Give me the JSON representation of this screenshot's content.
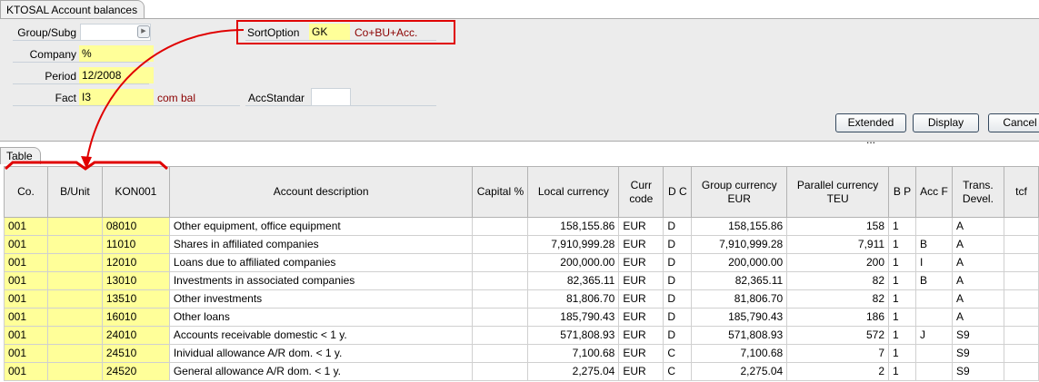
{
  "window": {
    "title": "KTOSAL Account balances"
  },
  "form": {
    "group_label": "Group/Subg",
    "group_value": "",
    "company_label": "Company",
    "company_value": "%",
    "period_label": "Period",
    "period_value": "12/2008",
    "fact_label": "Fact",
    "fact_value": "I3",
    "fact_desc": "com bal",
    "sort_label": "SortOption",
    "sort_value": "GK",
    "sort_desc": "Co+BU+Acc.",
    "accstd_label": "AccStandar",
    "accstd_value": ""
  },
  "buttons": {
    "extended": "Extended ...",
    "display": "Display",
    "cancel": "Cancel"
  },
  "table": {
    "tab_label": "Table",
    "headers": {
      "co": "Co.",
      "bunit": "B/Unit",
      "kon": "KON001",
      "desc": "Account description",
      "capital": "Capital %",
      "local": "Local currency",
      "curr": "Curr code",
      "dc": "D C",
      "group": "Group currency EUR",
      "parallel": "Parallel currency TEU",
      "bp": "B P",
      "acc": "Acc F",
      "trans": "Trans. Devel.",
      "tcf": "tcf"
    },
    "rows": [
      {
        "co": "001",
        "bunit": "",
        "kon": "08010",
        "desc": "Other equipment, office equipment",
        "capital": "",
        "local": "158,155.86",
        "curr": "EUR",
        "dc": "D",
        "group": "158,155.86",
        "parallel": "158",
        "bp": "1",
        "acc": "",
        "trans": "A",
        "tcf": ""
      },
      {
        "co": "001",
        "bunit": "",
        "kon": "11010",
        "desc": "Shares in affiliated companies",
        "capital": "",
        "local": "7,910,999.28",
        "curr": "EUR",
        "dc": "D",
        "group": "7,910,999.28",
        "parallel": "7,911",
        "bp": "1",
        "acc": "B",
        "trans": "A",
        "tcf": ""
      },
      {
        "co": "001",
        "bunit": "",
        "kon": "12010",
        "desc": "Loans due to affiliated companies",
        "capital": "",
        "local": "200,000.00",
        "curr": "EUR",
        "dc": "D",
        "group": "200,000.00",
        "parallel": "200",
        "bp": "1",
        "acc": "I",
        "trans": "A",
        "tcf": ""
      },
      {
        "co": "001",
        "bunit": "",
        "kon": "13010",
        "desc": "Investments in associated companies",
        "capital": "",
        "local": "82,365.11",
        "curr": "EUR",
        "dc": "D",
        "group": "82,365.11",
        "parallel": "82",
        "bp": "1",
        "acc": "B",
        "trans": "A",
        "tcf": ""
      },
      {
        "co": "001",
        "bunit": "",
        "kon": "13510",
        "desc": "Other investments",
        "capital": "",
        "local": "81,806.70",
        "curr": "EUR",
        "dc": "D",
        "group": "81,806.70",
        "parallel": "82",
        "bp": "1",
        "acc": "",
        "trans": "A",
        "tcf": ""
      },
      {
        "co": "001",
        "bunit": "",
        "kon": "16010",
        "desc": "Other loans",
        "capital": "",
        "local": "185,790.43",
        "curr": "EUR",
        "dc": "D",
        "group": "185,790.43",
        "parallel": "186",
        "bp": "1",
        "acc": "",
        "trans": "A",
        "tcf": ""
      },
      {
        "co": "001",
        "bunit": "",
        "kon": "24010",
        "desc": "Accounts receivable domestic < 1 y.",
        "capital": "",
        "local": "571,808.93",
        "curr": "EUR",
        "dc": "D",
        "group": "571,808.93",
        "parallel": "572",
        "bp": "1",
        "acc": "J",
        "trans": "S9",
        "tcf": ""
      },
      {
        "co": "001",
        "bunit": "",
        "kon": "24510",
        "desc": "Inividual allowance A/R dom. < 1 y.",
        "capital": "",
        "local": "7,100.68",
        "curr": "EUR",
        "dc": "C",
        "group": "7,100.68",
        "parallel": "7",
        "bp": "1",
        "acc": "",
        "trans": "S9",
        "tcf": ""
      },
      {
        "co": "001",
        "bunit": "",
        "kon": "24520",
        "desc": "General allowance A/R dom. < 1 y.",
        "capital": "",
        "local": "2,275.04",
        "curr": "EUR",
        "dc": "C",
        "group": "2,275.04",
        "parallel": "2",
        "bp": "1",
        "acc": "",
        "trans": "S9",
        "tcf": ""
      }
    ]
  },
  "colors": {
    "highlight": "#ffff99",
    "annotation": "#e00000",
    "desc_text": "#8b0000"
  }
}
